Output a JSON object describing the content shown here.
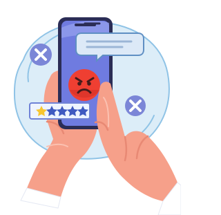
{
  "illustration": {
    "colors": {
      "background": "#ffffff",
      "blob": "#dcedf8",
      "blob_stroke": "#8fc3e6",
      "bubble_fill": "#dce9f7",
      "bubble_stroke": "#5f8fc3",
      "phone_outer": "#2b2d56",
      "phone_screen": "#6f7be0",
      "phone_screen_glow": "#99a6f0",
      "skin": "#f6a08a",
      "skin_shadow": "#e88974",
      "skin_highlight": "#fbc1b1",
      "sleeve": "#ffffff",
      "emoji": "#ef3f32",
      "emoji_shadow": "#c92c24",
      "x_badge": "#7b86d7",
      "rating_card": "#eef4ff",
      "rating_border": "#6f82d6",
      "star_filled": "#f7c631",
      "star_empty": "#3f5ac0"
    },
    "icons": {
      "badge_left": "close-icon",
      "badge_right": "close-icon",
      "emoji": "angry-face-icon"
    },
    "rating": {
      "filled_stars": 1,
      "total_stars": 5
    }
  }
}
